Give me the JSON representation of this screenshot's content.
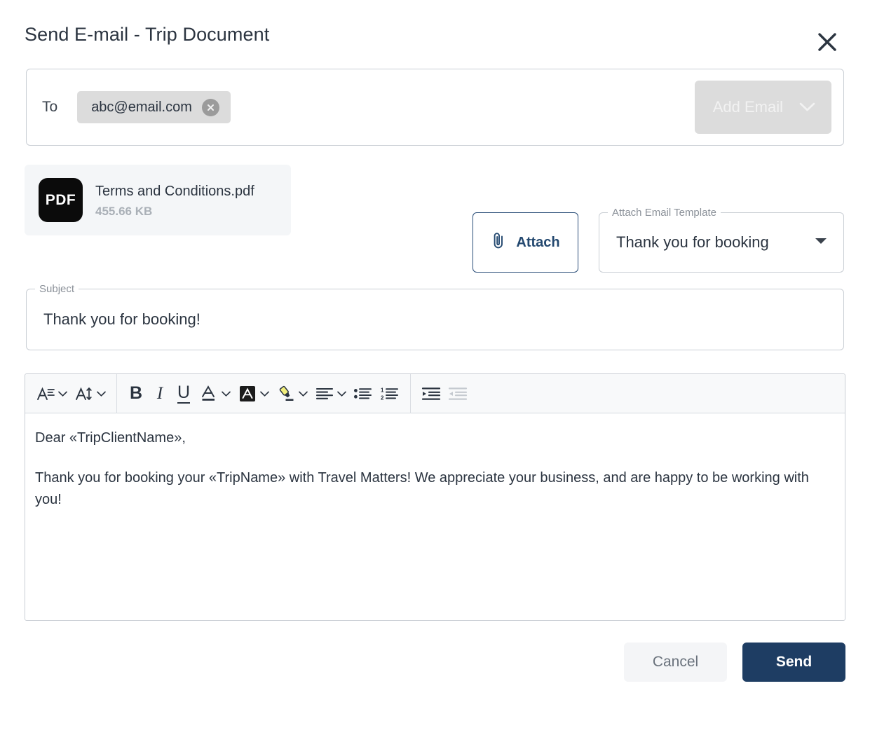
{
  "dialog": {
    "title": "Send E-mail - Trip Document",
    "close_label": "Close"
  },
  "recipients": {
    "legend": "",
    "label": "To",
    "chips": [
      {
        "email": "abc@email.com",
        "remove_label": "Remove"
      }
    ],
    "add_email_label": "Add Email"
  },
  "attachments": [
    {
      "badge": "PDF",
      "name": "Terms and Conditions.pdf",
      "size": "455.66 KB"
    }
  ],
  "tools": {
    "attach_label": "Attach",
    "template": {
      "legend": "Attach Email Template",
      "value": "Thank you for booking"
    }
  },
  "subject": {
    "legend": "Subject",
    "value": "Thank you for booking!"
  },
  "editor": {
    "toolbar": {
      "groups": [
        {
          "items": [
            {
              "icon": "font-family-icon",
              "name": "font-family-button",
              "caret": true
            },
            {
              "icon": "font-size-icon",
              "name": "font-size-button",
              "caret": true
            }
          ]
        },
        {
          "items": [
            {
              "icon": "bold-icon",
              "name": "bold-button",
              "glyph": "B",
              "caret": false
            },
            {
              "icon": "italic-icon",
              "name": "italic-button",
              "glyph": "I",
              "caret": false
            },
            {
              "icon": "underline-icon",
              "name": "underline-button",
              "glyph": "U",
              "caret": false
            },
            {
              "icon": "text-color-icon",
              "name": "text-color-button",
              "caret": true
            },
            {
              "icon": "background-color-icon",
              "name": "background-color-button",
              "caret": true
            },
            {
              "icon": "highlight-icon",
              "name": "highlight-button",
              "caret": true
            },
            {
              "icon": "align-left-icon",
              "name": "align-button",
              "caret": true
            },
            {
              "icon": "bulleted-list-icon",
              "name": "bulleted-list-button",
              "caret": false
            },
            {
              "icon": "numbered-list-icon",
              "name": "numbered-list-button",
              "caret": false
            }
          ]
        },
        {
          "items": [
            {
              "icon": "indent-icon",
              "name": "indent-button",
              "caret": false
            },
            {
              "icon": "outdent-icon",
              "name": "outdent-button",
              "caret": false,
              "disabled": true
            }
          ]
        }
      ]
    },
    "body": [
      "Dear «TripClientName»,",
      "Thank you for booking your «TripName» with Travel Matters! We appreciate your business, and are happy to be working with you!"
    ]
  },
  "footer": {
    "cancel_label": "Cancel",
    "send_label": "Send"
  },
  "colors": {
    "accent_navy": "#1e3d63",
    "attach_border": "#2a4d78",
    "chip_bg": "#dcdcdc",
    "highlight_yellow": "#f2ef7c",
    "attachment_card_bg": "#f4f6f8",
    "toolbar_bg": "#f8f9fa"
  }
}
